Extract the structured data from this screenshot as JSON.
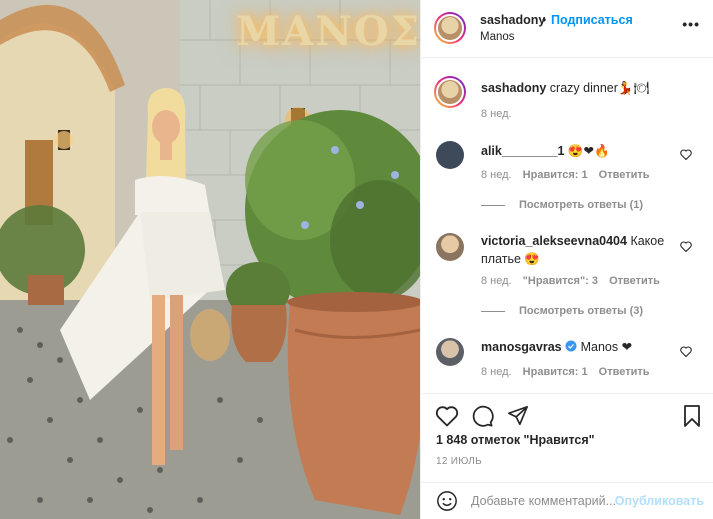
{
  "photo": {
    "sign_text": "MANOΣ"
  },
  "header": {
    "username": "sashadony",
    "separator": "•",
    "follow_label": "Подписаться",
    "location": "Manos",
    "more_icon": "more-dots-icon"
  },
  "caption": {
    "username": "sashadony",
    "text": "crazy dinner",
    "emojis": "💃🍽",
    "time": "8 нед."
  },
  "comments": [
    {
      "username": "alik________1",
      "text": "😍❤🔥",
      "time": "8 нед.",
      "likes_label": "Нравится: 1",
      "reply_label": "Ответить",
      "replies_label": "Посмотреть ответы (1)"
    },
    {
      "username": "victoria_alekseevna0404",
      "text_line1": "Какое",
      "text_line2": "платье 😍",
      "time": "8 нед.",
      "likes_label": "\"Нравится\": 3",
      "reply_label": "Ответить",
      "replies_label": "Посмотреть ответы (3)"
    },
    {
      "username": "manosgavras",
      "verified_icon": "verified-badge-icon",
      "text": "Manos ❤",
      "time": "8 нед.",
      "likes_label": "Нравится: 1",
      "reply_label": "Ответить"
    }
  ],
  "actions": {
    "like_icon": "heart-icon",
    "comment_icon": "comment-icon",
    "share_icon": "share-icon",
    "save_icon": "bookmark-icon"
  },
  "likes_text": "1 848 отметок \"Нравится\"",
  "date_text": "12 ИЮЛЬ",
  "composer": {
    "emoji_icon": "emoji-icon",
    "placeholder": "Добавьте комментарий...",
    "visible_text": "Добавьте комментарий...",
    "publish_label": "Опубликовать"
  },
  "colors": {
    "link_blue": "#0095f6",
    "disabled_blue": "#b2dffc",
    "muted_gray": "#8e8e8e",
    "heart_red": "#ed4956"
  }
}
